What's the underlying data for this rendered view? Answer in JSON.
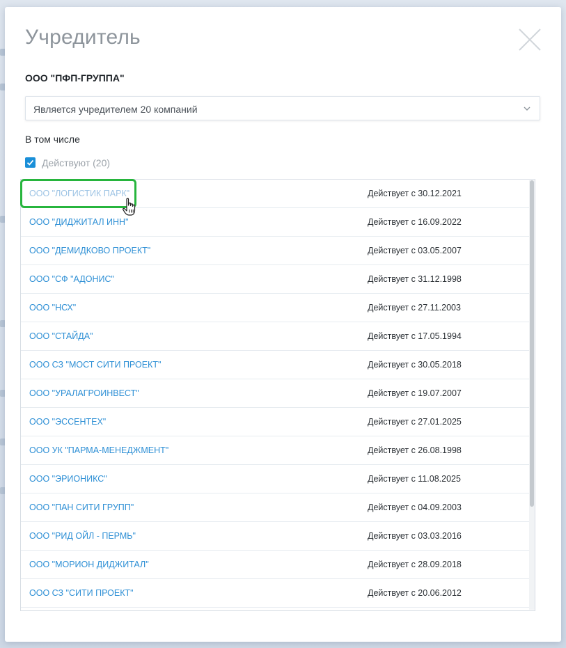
{
  "modal": {
    "title": "Учредитель",
    "company_name": "ООО \"ПФП-ГРУППА\"",
    "select": {
      "value": "Является учредителем 20 компаний"
    },
    "including_label": "В том числе",
    "filter": {
      "label": "Действуют (20)",
      "checked": true
    }
  },
  "companies": [
    {
      "name": "ООО \"ЛОГИСТИК ПАРК\"",
      "status": "Действует с 30.12.2021"
    },
    {
      "name": "ООО \"ДИДЖИТАЛ ИНН\"",
      "status": "Действует с 16.09.2022"
    },
    {
      "name": "ООО \"ДЕМИДКОВО ПРОЕКТ\"",
      "status": "Действует с 03.05.2007"
    },
    {
      "name": "ООО \"СФ \"АДОНИС\"",
      "status": "Действует с 31.12.1998"
    },
    {
      "name": "ООО \"НСХ\"",
      "status": "Действует с 27.11.2003"
    },
    {
      "name": "ООО \"СТАЙДА\"",
      "status": "Действует с 17.05.1994"
    },
    {
      "name": "ООО СЗ \"МОСТ СИТИ ПРОЕКТ\"",
      "status": "Действует с 30.05.2018"
    },
    {
      "name": "ООО \"УРАЛАГРОИНВЕСТ\"",
      "status": "Действует с 19.07.2007"
    },
    {
      "name": "ООО \"ЭССЕНТЕХ\"",
      "status": "Действует с 27.01.2025"
    },
    {
      "name": "ООО УК \"ПАРМА-МЕНЕДЖМЕНТ\"",
      "status": "Действует с 26.08.1998"
    },
    {
      "name": "ООО \"ЭРИОНИКС\"",
      "status": "Действует с 11.08.2025"
    },
    {
      "name": "ООО \"ПАН СИТИ ГРУПП\"",
      "status": "Действует с 04.09.2003"
    },
    {
      "name": "ООО \"РИД ОЙЛ - ПЕРМЬ\"",
      "status": "Действует с 03.03.2016"
    },
    {
      "name": "ООО \"МОРИОН ДИДЖИТАЛ\"",
      "status": "Действует с 28.09.2018"
    },
    {
      "name": "ООО СЗ \"СИТИ ПРОЕКТ\"",
      "status": "Действует с 20.06.2012"
    }
  ],
  "icons": {
    "close": "close-icon",
    "select_arrow": "chevron-down-icon",
    "checkbox": "checkmark-icon",
    "cursor": "hand-pointer-icon"
  },
  "colors": {
    "link": "#2d8fd5",
    "link_hovered": "#9cc3e4",
    "highlight": "#27b53d",
    "checkbox": "#1a8fd8"
  },
  "scroll": {
    "thumb_fraction": 0.76
  }
}
